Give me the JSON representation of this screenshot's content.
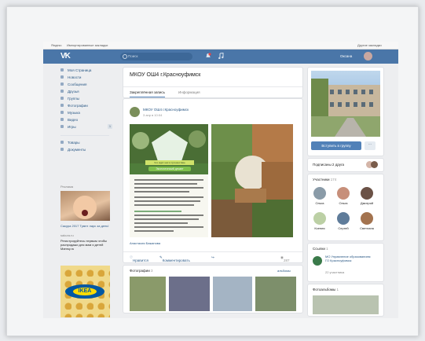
{
  "browser": {
    "bookmarks_left": "Яндекс",
    "bookmarks_imported": "Импортированные закладки",
    "bookmarks_right": "Другие закладки"
  },
  "header": {
    "logo": "VK",
    "search_placeholder": "Поиск",
    "user_name": "Оксана"
  },
  "left_menu": {
    "items": [
      {
        "label": "Моя Страница",
        "icon": "home-icon"
      },
      {
        "label": "Новости",
        "icon": "news-icon"
      },
      {
        "label": "Сообщения",
        "icon": "messages-icon"
      },
      {
        "label": "Друзья",
        "icon": "friends-icon"
      },
      {
        "label": "Группы",
        "icon": "groups-icon"
      },
      {
        "label": "Фотографии",
        "icon": "photos-icon"
      },
      {
        "label": "Музыка",
        "icon": "music-icon"
      },
      {
        "label": "Видео",
        "icon": "video-icon"
      },
      {
        "label": "Игры",
        "icon": "games-icon",
        "badge": "1"
      }
    ],
    "items2": [
      {
        "label": "Товары",
        "icon": "goods-icon"
      },
      {
        "label": "Документы",
        "icon": "docs-icon"
      }
    ],
    "ad_header": "Реклама",
    "ad1_title": "Сакура 2017 Тумпт ларс за день!",
    "ad1_sub": "sakura.ru",
    "ad2_text": "Регистрируйтесь первым чтобы распродажи для мам и детей Mamsy.ru",
    "ad3_logo": "IKEA"
  },
  "group": {
    "title": "МКОУ ОШ4 г.Красноуфимск",
    "tabs": [
      "Закреплённая запись",
      "Информация"
    ],
    "post_author": "МКОУ ОШ4 г.Красноуфимск",
    "post_date": "3 апр в 10:04",
    "post_link": "Анастасия Бажанова",
    "like_label": "Нравится",
    "comment_label": "Комментировать",
    "views": "287",
    "photos_title": "Фотографии",
    "photos_count": "3",
    "photos_all": "альбомы",
    "poster_banner": "Что ждёт нас в путешествие",
    "poster_title": "Экологический десант"
  },
  "right": {
    "join_button": "Вступить в группу",
    "more_button": "···",
    "friends_subscribed": "Подписаны 2 друга",
    "members_title": "Участники",
    "members_count": "174",
    "members": [
      {
        "name": "Ольга",
        "color": "#8a9ba8"
      },
      {
        "name": "Ольга",
        "color": "#c78f7a"
      },
      {
        "name": "Дмитрий",
        "color": "#6b5246"
      },
      {
        "name": "Ксения",
        "color": "#bcd0a5"
      },
      {
        "name": "Сергей",
        "color": "#5f7c9a"
      },
      {
        "name": "Светлана",
        "color": "#a3734f"
      }
    ],
    "links_title": "Ссылки",
    "links_count": "1",
    "community_name": "МО Управление образованием ГО Красноуфимск",
    "community_sub": "22 участника",
    "albums_title": "Фотоальбомы",
    "albums_count": "1"
  },
  "colors": {
    "vk_blue": "#4a76a8",
    "button_blue": "#5181b8",
    "link": "#2a5885"
  }
}
